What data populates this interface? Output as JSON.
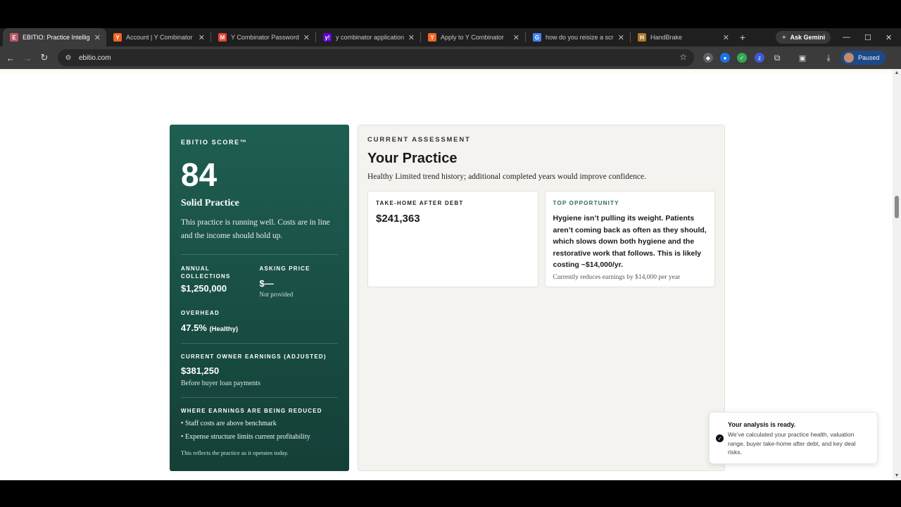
{
  "browser": {
    "tabs": [
      {
        "label": "EBITIO: Practice Intelligence",
        "favicon": "E",
        "favicon_color": "#c0566b",
        "active": true
      },
      {
        "label": "Account | Y Combinator",
        "favicon": "Y",
        "favicon_color": "#f26522",
        "active": false
      },
      {
        "label": "Y Combinator Password Re",
        "favicon": "M",
        "favicon_color": "#ea4335",
        "active": false
      },
      {
        "label": "y combinator application -",
        "favicon": "y!",
        "favicon_color": "#6001d2",
        "active": false
      },
      {
        "label": "Apply to Y Combinator",
        "favicon": "Y",
        "favicon_color": "#f26522",
        "active": false
      },
      {
        "label": "how do you reisize a scree",
        "favicon": "G",
        "favicon_color": "#4285f4",
        "active": false
      },
      {
        "label": "HandBrake",
        "favicon": "H",
        "favicon_color": "#b07a2a",
        "active": false
      }
    ],
    "new_tab": "+",
    "ask_gemini": "Ask Gemini",
    "url": "ebitio.com",
    "profile_status": "Paused"
  },
  "score_card": {
    "eyebrow": "EBITIO SCORE™",
    "score": "84",
    "label": "Solid Practice",
    "description": "This practice is running well. Costs are in line and the income should hold up.",
    "annual_collections": {
      "label": "ANNUAL COLLECTIONS",
      "value": "$1,250,000"
    },
    "asking_price": {
      "label": "ASKING PRICE",
      "value": "$—",
      "note": "Not provided"
    },
    "overhead": {
      "label": "OVERHEAD",
      "value": "47.5%",
      "status": "(Healthy)"
    },
    "owner_earnings": {
      "label": "CURRENT OWNER EARNINGS (ADJUSTED)",
      "value": "$381,250",
      "note": "Before buyer loan payments"
    },
    "reductions": {
      "label": "WHERE EARNINGS ARE BEING REDUCED",
      "items": [
        "• Staff costs are above benchmark",
        "• Expense structure limits current profitability"
      ]
    },
    "footnote": "This reflects the practice as it operates today."
  },
  "assessment": {
    "eyebrow": "CURRENT ASSESSMENT",
    "title": "Your Practice",
    "subtitle": "Healthy Limited trend history; additional completed years would improve confidence.",
    "take_home": {
      "label": "TAKE-HOME AFTER DEBT",
      "value": "$241,363"
    },
    "opportunity": {
      "label": "TOP OPPORTUNITY",
      "text": "Hygiene isn’t pulling its weight. Patients aren’t coming back as often as they should, which slows down both hygiene and the restorative work that follows. This is likely costing ~$14,000/yr.",
      "note": "Currently reduces earnings by $14,000 per year"
    }
  },
  "toast": {
    "title": "Your analysis is ready.",
    "body": "We’ve calculated your practice health, valuation range, buyer take-home after debt, and key deal risks."
  },
  "colors": {
    "brand_green": "#1f5e52",
    "panel_bg": "#f4f3ef",
    "opportunity_label": "#2b6a58"
  }
}
